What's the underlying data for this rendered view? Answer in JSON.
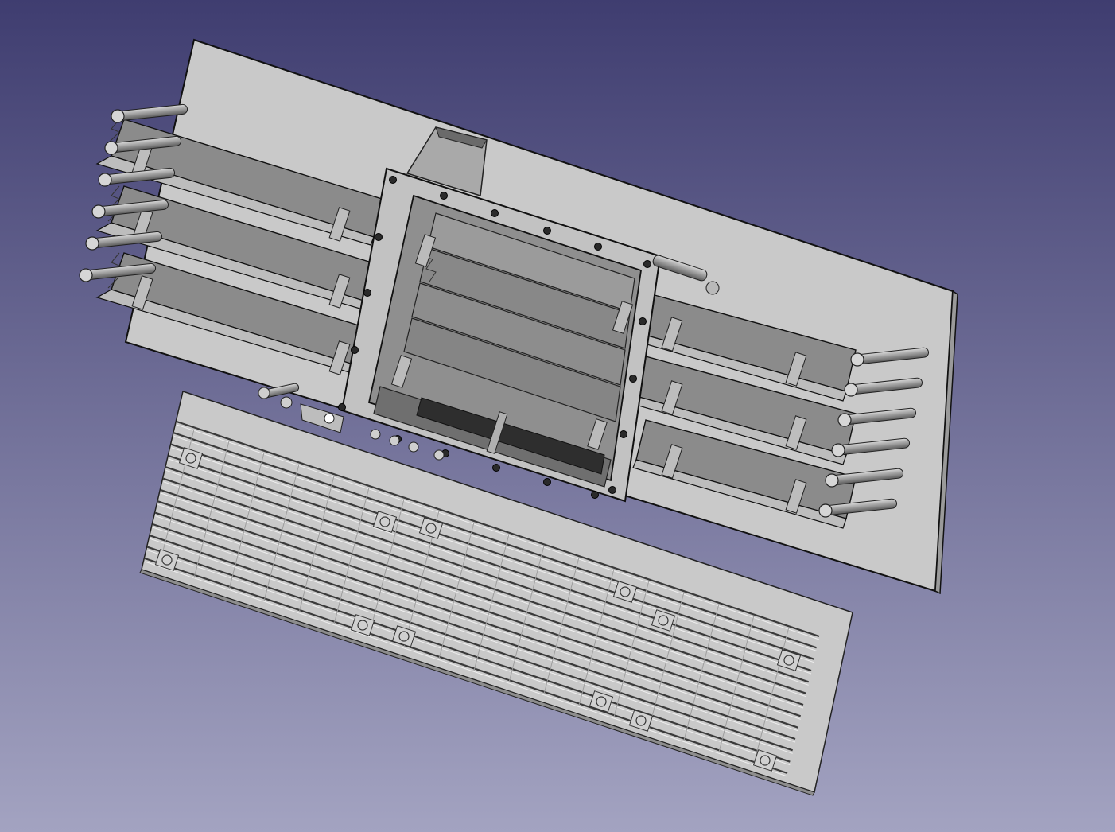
{
  "viewport": {
    "background_top": "#3f3d70",
    "background_bottom": "#a3a3c1"
  },
  "model": {
    "face_light": "#c9c9c9",
    "face_mid": "#a8a8a8",
    "face_dark": "#7d7d7d",
    "edge": "#111111",
    "pin_count_left": 6,
    "pin_count_right": 6,
    "plate_count": 3,
    "rail_count": 13
  }
}
